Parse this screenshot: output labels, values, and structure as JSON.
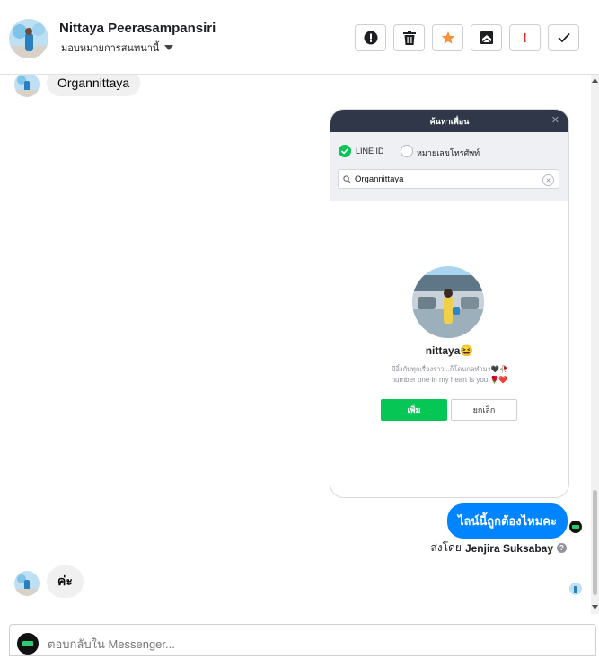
{
  "header": {
    "contact_name": "Nittaya Peerasampansiri",
    "assign_label": "มอบหมายการสนทนานี้",
    "toolbar": {
      "spam_icon": "alert-circle-icon",
      "delete_icon": "trash-icon",
      "star_icon": "star-icon",
      "unread_icon": "envelope-icon",
      "important_mark": "!",
      "done_icon": "check-icon"
    }
  },
  "messages": {
    "incoming_1": "Organnittaya",
    "line_shot": {
      "title": "ค้นหาเพื่อน",
      "option_line_id": "LINE ID",
      "option_phone": "หมายเลขโทรศัพท์",
      "search_value": "Organnittaya",
      "profile_name": "nittaya😆",
      "status_line_1": "มีอิ๋งกับทุกเรื่องราว...ก็โดนกลทำมา🖤🥀",
      "status_line_2": "number one in my heart is you 🌹❤️",
      "add_button": "เพิ่ม",
      "cancel_button": "ยกเลิก"
    },
    "outgoing_1": "ไลน์นี้ถูกต้องไหมคะ",
    "sent_by_prefix": "ส่งโดย",
    "sent_by_name": "Jenjira Suksabay",
    "incoming_2": "ค่ะ"
  },
  "reply": {
    "placeholder": "ตอบกลับใน Messenger..."
  },
  "colors": {
    "accent_blue": "#0084ff",
    "line_green": "#06c755",
    "star_orange": "#f7923a",
    "important_red": "#e4322b"
  }
}
